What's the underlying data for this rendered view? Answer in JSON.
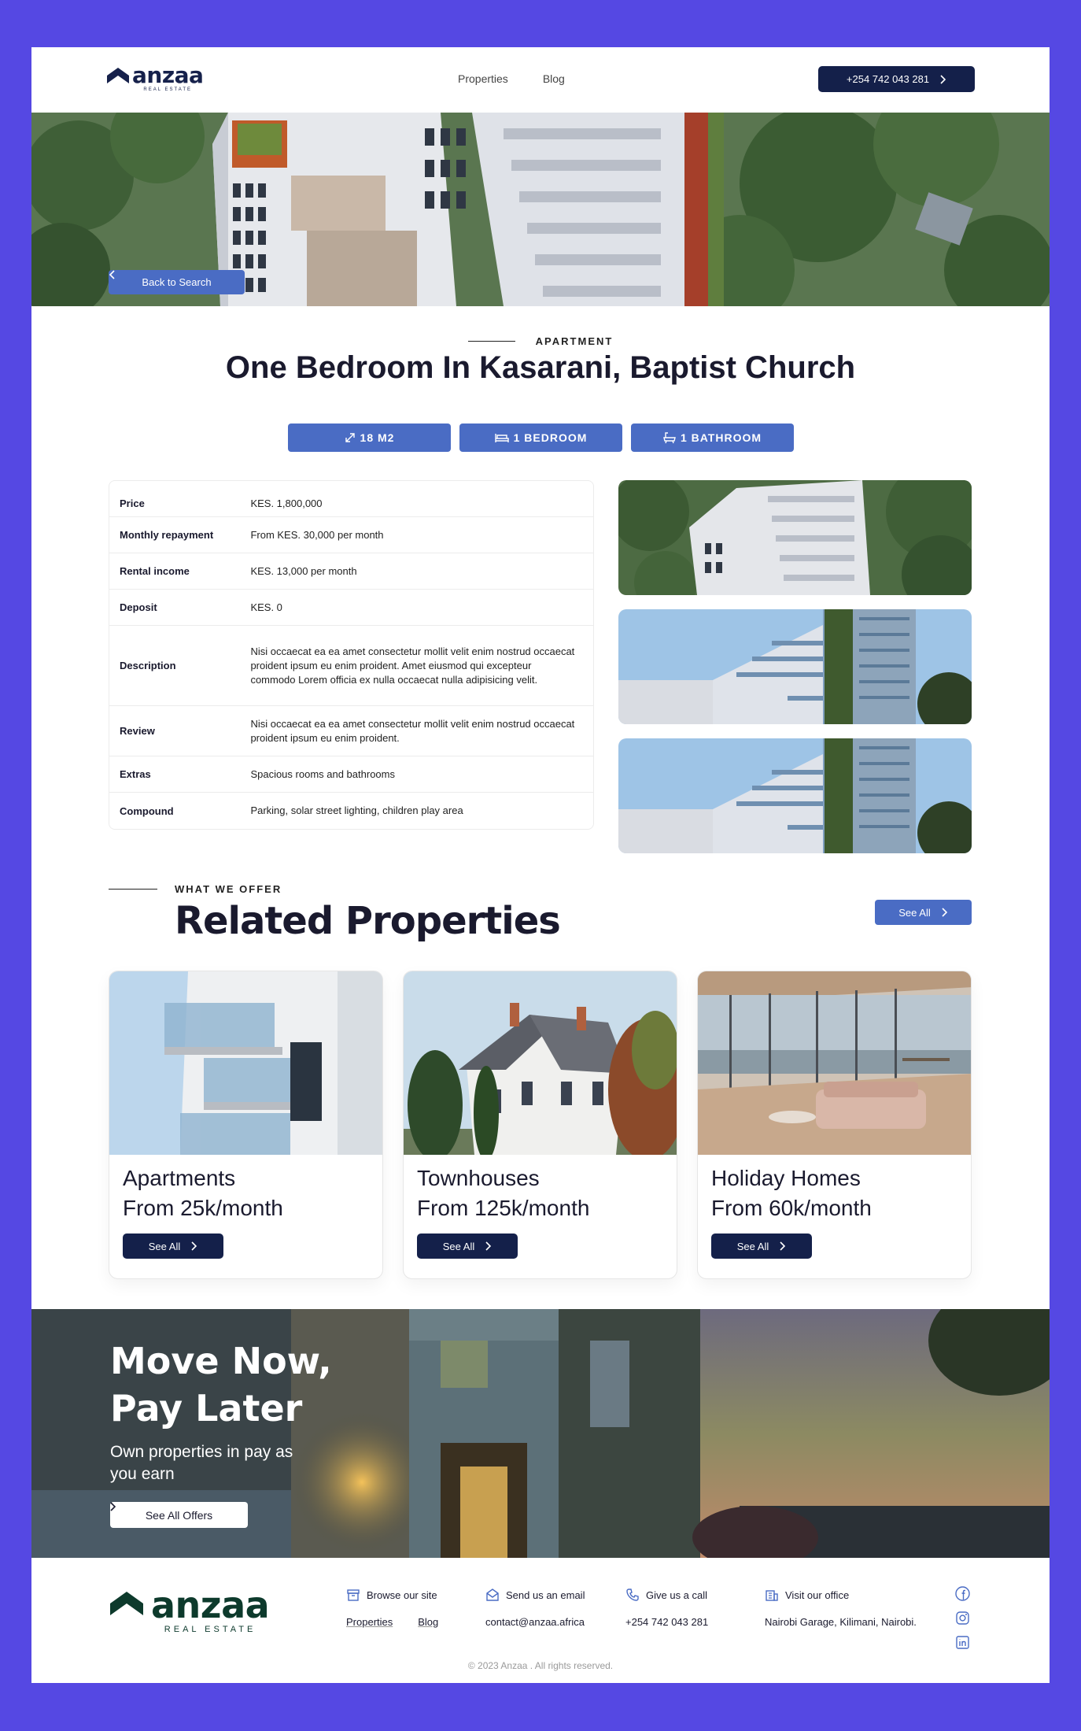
{
  "header": {
    "logo_word": "anzaa",
    "logo_sub": "REAL ESTATE",
    "nav": [
      "Properties",
      "Blog"
    ],
    "phone": "+254 742 043 281"
  },
  "hero": {
    "back_label": "Back to Search"
  },
  "listing": {
    "category": "APARTMENT",
    "title": "One Bedroom In Kasarani, Baptist Church",
    "chips": [
      "18 M2",
      "1 BEDROOM",
      "1 BATHROOM"
    ],
    "details": [
      {
        "key": "Price",
        "value": "KES. 1,800,000"
      },
      {
        "key": "Monthly repayment",
        "value": "From KES. 30,000 per month"
      },
      {
        "key": "Rental income",
        "value": "KES. 13,000 per month"
      },
      {
        "key": "Deposit",
        "value": "KES. 0"
      },
      {
        "key": "Description",
        "value": "Nisi occaecat ea ea amet consectetur mollit velit enim nostrud occaecat proident ipsum eu enim proident. Amet eiusmod qui excepteur commodo Lorem officia ex nulla occaecat nulla adipisicing velit."
      },
      {
        "key": "Review",
        "value": "Nisi occaecat ea ea amet consectetur mollit velit enim nostrud occaecat proident ipsum eu enim proident."
      },
      {
        "key": "Extras",
        "value": "Spacious rooms and bathrooms"
      },
      {
        "key": "Compound",
        "value": "Parking, solar street lighting, children play area"
      }
    ]
  },
  "related": {
    "eyebrow": "WHAT WE OFFER",
    "title": "Related Properties",
    "see_all": "See All",
    "cards": [
      {
        "title": "Apartments",
        "price": "From 25k/month",
        "button": "See All"
      },
      {
        "title": "Townhouses",
        "price": "From 125k/month",
        "button": "See All"
      },
      {
        "title": "Holiday Homes",
        "price": "From 60k/month",
        "button": "See All"
      }
    ]
  },
  "banner": {
    "title": "Move Now, Pay Later",
    "subtitle": "Own properties in pay as you earn",
    "button": "See All Offers"
  },
  "footer": {
    "logo_word": "anzaa",
    "logo_sub": "REAL ESTATE",
    "browse": {
      "label": "Browse our site",
      "links": [
        "Properties",
        "Blog"
      ]
    },
    "email": {
      "label": "Send us an email",
      "value": "contact@anzaa.africa"
    },
    "call": {
      "label": "Give us a call",
      "value": "+254 742 043 281"
    },
    "office": {
      "label": "Visit our office",
      "value": "Nairobi Garage, Kilimani, Nairobi."
    },
    "copyright": "© 2023 Anzaa . All rights reserved."
  },
  "colors": {
    "frame": "#5548e3",
    "navy": "#14204a",
    "accent_blue": "#4a6cc4",
    "footer_green": "#0d3a2c"
  }
}
